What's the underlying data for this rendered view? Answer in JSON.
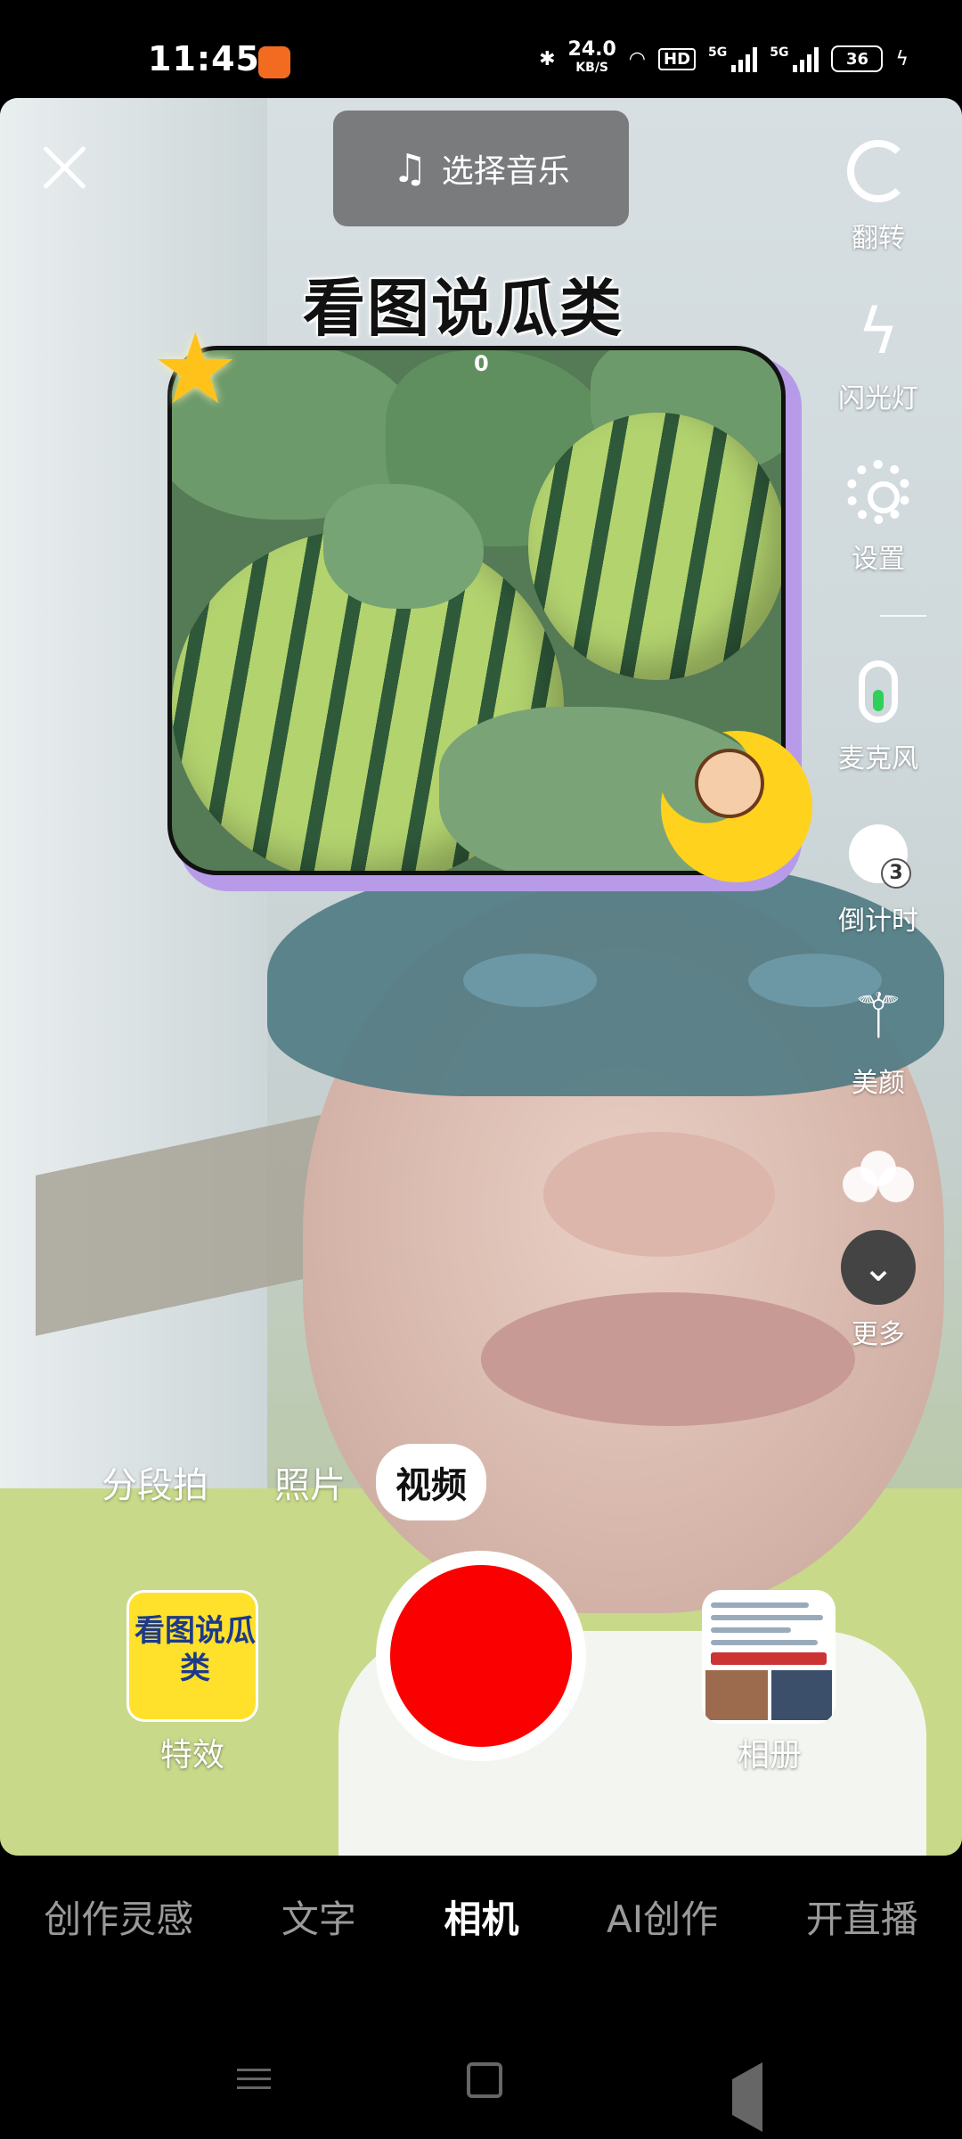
{
  "status_bar": {
    "time": "11:45",
    "net_speed": "24.0",
    "net_speed_unit": "KB/S",
    "hd_label": "HD",
    "sim1_label": "5G",
    "sim2_label": "5G",
    "battery": "36"
  },
  "camera": {
    "music_label": "选择音乐",
    "sticker_title": "看图说瓜类",
    "sticker_count": "0",
    "effect_thumb_text": "看图说瓜类"
  },
  "right_toolbar": {
    "items": [
      {
        "label": "翻转",
        "icon": "flip-camera-icon"
      },
      {
        "label": "闪光灯",
        "icon": "flash-off-icon"
      },
      {
        "label": "设置",
        "icon": "gear-icon"
      },
      {
        "label": "麦克风",
        "icon": "microphone-icon"
      },
      {
        "label": "倒计时",
        "icon": "timer-icon"
      },
      {
        "label": "美颜",
        "icon": "beauty-wand-icon"
      },
      {
        "label": "",
        "icon": "filter-bubbles-icon"
      },
      {
        "label": "更多",
        "icon": "chevron-down-icon"
      }
    ]
  },
  "modes": {
    "items": [
      "分段拍",
      "照片",
      "视频"
    ],
    "selected": "视频"
  },
  "capture": {
    "effects_label": "特效",
    "album_label": "相册",
    "shutter_color": "#fb0000"
  },
  "bottom_nav": {
    "tabs": [
      "创作灵感",
      "文字",
      "相机",
      "AI创作",
      "开直播"
    ],
    "active": "相机"
  }
}
